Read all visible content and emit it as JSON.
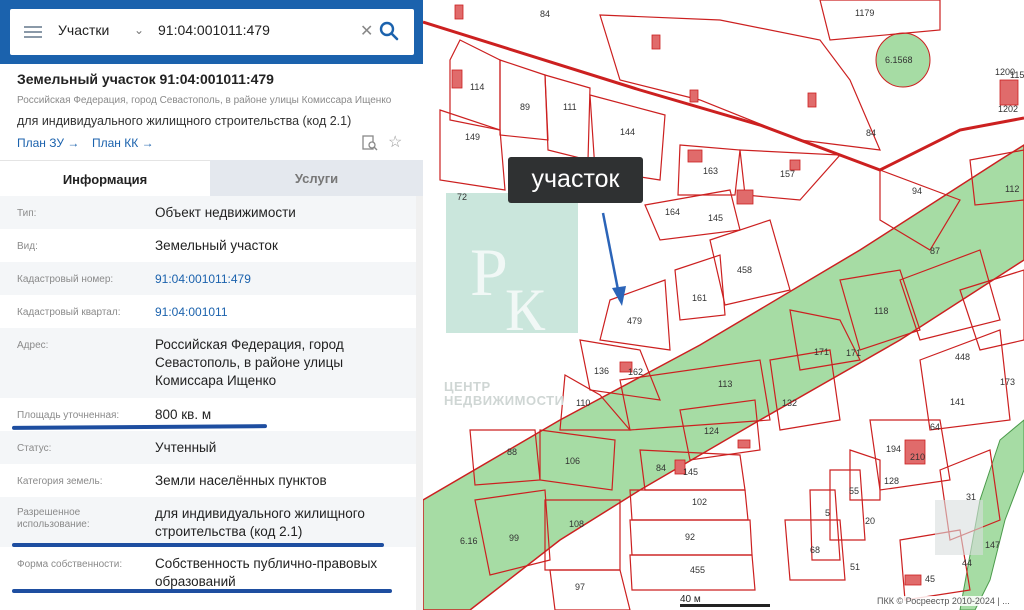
{
  "search": {
    "layer": "Участки",
    "query": "91:04:001011:479"
  },
  "object": {
    "title": "Земельный участок 91:04:001011:479",
    "address_short": "Российская Федерация, город Севастополь, в районе улицы Комиссара Ищенко",
    "purpose": "для индивидуального жилищного строительства (код 2.1)",
    "link_plan_zu": "План ЗУ →",
    "link_plan_kk": "План КК →"
  },
  "tabs": {
    "info": "Информация",
    "services": "Услуги"
  },
  "properties": [
    {
      "label": "Тип:",
      "value": "Объект недвижимости"
    },
    {
      "label": "Вид:",
      "value": "Земельный участок"
    },
    {
      "label": "Кадастровый номер:",
      "value": "91:04:001011:479"
    },
    {
      "label": "Кадастровый квартал:",
      "value": "91:04:001011"
    },
    {
      "label": "Адрес:",
      "value": "Российская Федерация, город Севастополь, в районе улицы Комиссара Ищенко"
    },
    {
      "label": "Площадь уточненная:",
      "value": "800 кв. м"
    },
    {
      "label": "Статус:",
      "value": "Учтенный"
    },
    {
      "label": "Категория земель:",
      "value": "Земли населённых пунктов"
    },
    {
      "label": "Разрешенное использование:",
      "value": "для индивидуального жилищного строительства (код 2.1)"
    },
    {
      "label": "Форма собственности:",
      "value": "Собственность публично-правовых образований"
    }
  ],
  "map": {
    "callout": "участок",
    "scale": "40 м",
    "copyright": "ПКК © Росреестр 2010-2024 | ...",
    "watermark": "ЦЕНТР НЕДВИЖИМОСТИ",
    "parcel_labels": [
      "84",
      "1179",
      "6.1568",
      "1200",
      "1150",
      "1202",
      "114",
      "89",
      "111",
      "144",
      "149",
      "84",
      "163",
      "157",
      "94",
      "112",
      "72",
      "164",
      "145",
      "458",
      "87",
      "161",
      "479",
      "118",
      "171",
      "171",
      "448",
      "173",
      "136",
      "162",
      "113",
      "110",
      "132",
      "141",
      "124",
      "64",
      "88",
      "106",
      "84",
      "145",
      "194",
      "210",
      "128",
      "55",
      "31",
      "102",
      "20",
      "5",
      "99",
      "108",
      "92",
      "97",
      "455",
      "68",
      "51",
      "6.16",
      "45",
      "44",
      "147"
    ]
  },
  "colors": {
    "header_blue": "#1b62ad",
    "parcel_red": "#cc2020",
    "zone_green": "#9bd89b",
    "callout_bg": "#2f3132"
  }
}
